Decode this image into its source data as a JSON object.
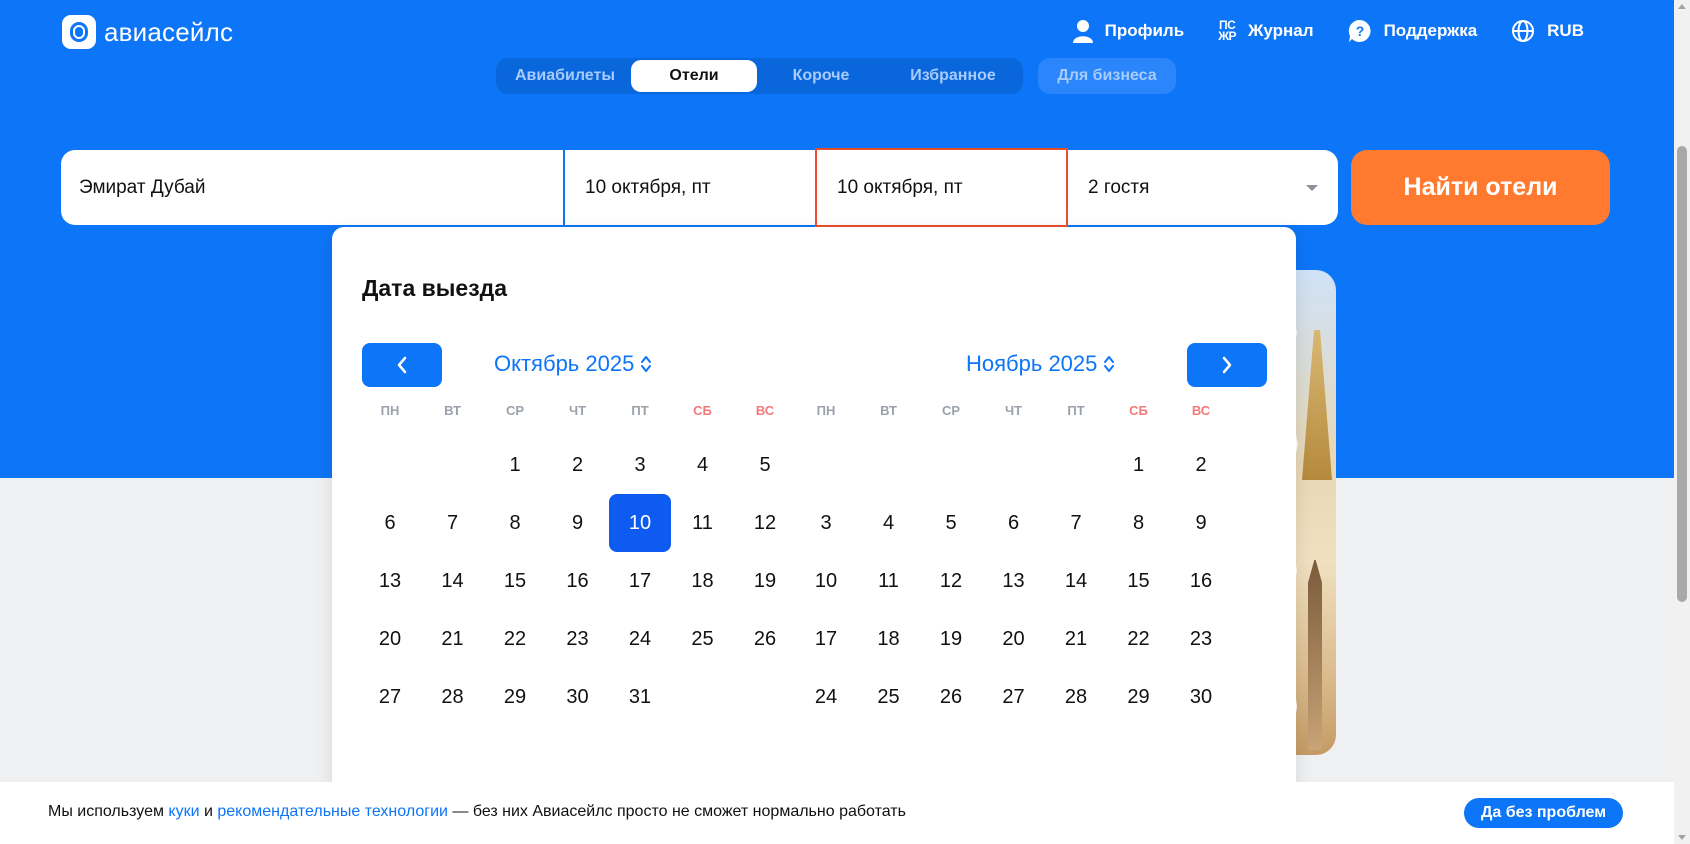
{
  "header": {
    "logo_text": "авиасейлс",
    "nav": [
      {
        "label": "Профиль",
        "icon": "person-icon"
      },
      {
        "label": "Журнал",
        "icon": "journal-icon",
        "icon_text": [
          "ПС",
          "ЖР"
        ]
      },
      {
        "label": "Поддержка",
        "icon": "help-icon"
      },
      {
        "label": "RUB",
        "icon": "globe-icon"
      }
    ]
  },
  "tabs": {
    "items": [
      "Авиабилеты",
      "Отели",
      "Короче",
      "Избранное"
    ],
    "active": "Отели",
    "business": "Для бизнеса"
  },
  "search": {
    "destination": "Эмират Дубай",
    "checkin": "10 октября, пт",
    "checkout": "10 октября, пт",
    "guests": "2 гостя",
    "submit": "Найти отели"
  },
  "calendar": {
    "title": "Дата выезда",
    "weekdays": [
      "ПН",
      "ВТ",
      "СР",
      "ЧТ",
      "ПТ",
      "СБ",
      "ВС"
    ],
    "months": [
      {
        "label": "Октябрь 2025",
        "first_weekday": 2,
        "days": 31
      },
      {
        "label": "Ноябрь 2025",
        "first_weekday": 5,
        "days": 30
      }
    ],
    "selected": {
      "month": 0,
      "day": 10
    },
    "accent_color": "#0d75f7",
    "weekend_color": "#f27a7a"
  },
  "cookie": {
    "prefix": "Мы используем ",
    "link1": "куки",
    "middle": " и ",
    "link2": "рекомендательные технологии",
    "suffix": " — без них Авиасейлс просто не сможет нормально работать",
    "accept": "Да без проблем"
  },
  "colors": {
    "brand_blue": "#0d75f7",
    "search_orange": "#ff7a2f",
    "checkout_border": "#e8502b"
  }
}
